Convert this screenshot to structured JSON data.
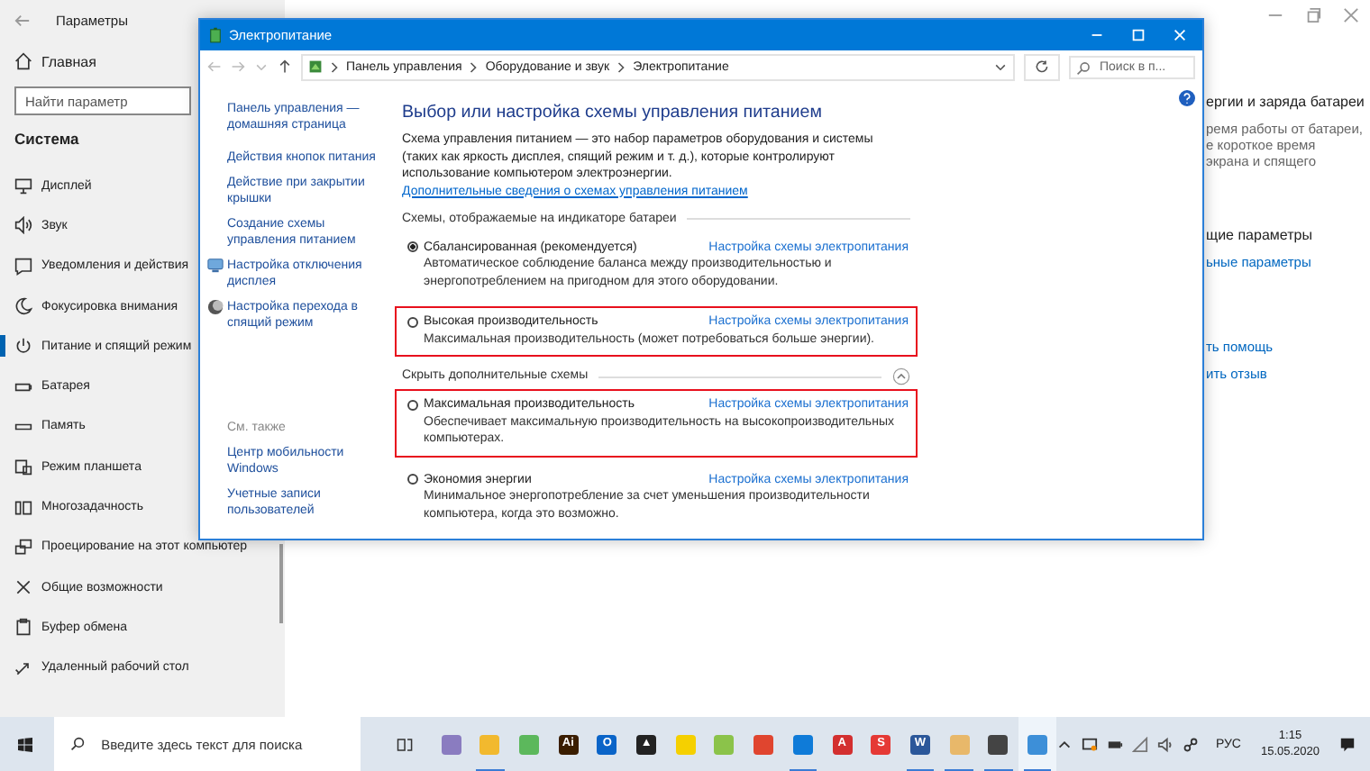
{
  "settings": {
    "title": "Параметры",
    "home": "Главная",
    "search": {
      "placeholder": "Найти параметр"
    },
    "section": "Система",
    "items": [
      {
        "label": "Дисплей",
        "selected": false
      },
      {
        "label": "Звук",
        "selected": false
      },
      {
        "label": "Уведомления и действия",
        "selected": false
      },
      {
        "label": "Фокусировка внимания",
        "selected": false
      },
      {
        "label": "Питание и спящий режим",
        "selected": true
      },
      {
        "label": "Батарея",
        "selected": false
      },
      {
        "label": "Память",
        "selected": false
      },
      {
        "label": "Режим планшета",
        "selected": false
      },
      {
        "label": "Многозадачность",
        "selected": false
      },
      {
        "label": "Проецирование на этот компьютер",
        "selected": false
      },
      {
        "label": "Общие возможности",
        "selected": false
      },
      {
        "label": "Буфер обмена",
        "selected": false
      },
      {
        "label": "Удаленный рабочий стол",
        "selected": false
      }
    ],
    "content": [
      {
        "kind": "heading",
        "text": "ергии и заряда батареи"
      },
      {
        "kind": "note",
        "text": "ремя работы от батареи,"
      },
      {
        "kind": "note",
        "text": "е короткое время"
      },
      {
        "kind": "note",
        "text": "экрана и спящего"
      },
      {
        "kind": "gap"
      },
      {
        "kind": "heading",
        "text": "щие параметры"
      },
      {
        "kind": "link",
        "text": "ьные параметры"
      },
      {
        "kind": "gap"
      },
      {
        "kind": "link",
        "text": "ть помощь"
      },
      {
        "kind": "link",
        "text": "ить отзыв"
      }
    ]
  },
  "window": {
    "title": "Электропитание",
    "breadcrumb": [
      "Панель управления",
      "Оборудование и звук",
      "Электропитание"
    ],
    "search": {
      "placeholder": "Поиск в п..."
    },
    "nav": [
      {
        "label": "Панель управления — домашняя страница",
        "kind": "plain"
      },
      {
        "label": "Действия кнопок питания",
        "kind": "plain"
      },
      {
        "label": "Действие при закрытии крышки",
        "kind": "plain"
      },
      {
        "label": "Создание схемы управления питанием",
        "kind": "plain"
      },
      {
        "label": "Настройка отключения дисплея",
        "kind": "display"
      },
      {
        "label": "Настройка перехода в спящий режим",
        "kind": "sleep"
      }
    ],
    "see_also": {
      "title": "См. также",
      "links": [
        "Центр мобильности Windows",
        "Учетные записи пользователей"
      ]
    },
    "heading": "Выбор или настройка схемы управления питанием",
    "description": "Схема управления питанием — это набор параметров оборудования и системы (таких как яркость дисплея, спящий режим и т. д.), которые контролируют использование компьютером электроэнергии.",
    "more_link": "Дополнительные сведения о схемах управления питанием",
    "sections": [
      {
        "kind": "header",
        "title": "Схемы, отображаемые на индикаторе батареи",
        "plans": [
          {
            "name": "Сбалансированная (рекомендуется)",
            "description": "Автоматическое соблюдение баланса между производительностью и энергопотреблением на пригодном для этого оборудовании.",
            "link": "Настройка схемы электропитания",
            "selected": true,
            "highlighted": false
          },
          {
            "name": "Высокая производительность",
            "description": "Максимальная производительность (может потребоваться больше энергии).",
            "link": "Настройка схемы электропитания",
            "selected": false,
            "highlighted": true
          }
        ]
      },
      {
        "kind": "toggle",
        "title": "Скрыть дополнительные схемы",
        "expanded": true,
        "plans": [
          {
            "name": "Максимальная производительность",
            "description": "Обеспечивает максимальную производительность на высокопроизводительных компьютерах.",
            "link": "Настройка схемы электропитания",
            "selected": false,
            "highlighted": true
          },
          {
            "name": "Экономия энергии",
            "description": "Минимальное энергопотребление за счет уменьшения производительности компьютера, когда это возможно.",
            "link": "Настройка схемы электропитания",
            "selected": false,
            "highlighted": false
          }
        ]
      }
    ]
  },
  "taskbar": {
    "search": {
      "placeholder": "Введите здесь текст для поиска"
    },
    "apps": [
      {
        "color": "#8a7cc0",
        "running": false,
        "selected": false
      },
      {
        "color": "#f2b92e",
        "running": true,
        "selected": false
      },
      {
        "color": "#5cb85c",
        "running": false,
        "selected": false
      },
      {
        "color": "#3a1d00",
        "glyph": "Ai",
        "running": false,
        "selected": false
      },
      {
        "color": "#0a64c8",
        "glyph": "O",
        "running": false,
        "selected": false
      },
      {
        "color": "#222222",
        "glyph": "▲",
        "running": false,
        "selected": false
      },
      {
        "color": "#f5d000",
        "running": false,
        "selected": false
      },
      {
        "color": "#8bc34a",
        "running": false,
        "selected": false
      },
      {
        "color": "#e0452f",
        "running": false,
        "selected": false
      },
      {
        "color": "#0f7bd8",
        "running": true,
        "selected": false
      },
      {
        "color": "#d32f2f",
        "glyph": "A",
        "running": false,
        "selected": false
      },
      {
        "color": "#e53935",
        "glyph": "S",
        "running": false,
        "selected": false
      },
      {
        "color": "#2b579a",
        "glyph": "W",
        "running": true,
        "selected": false
      },
      {
        "color": "#e8b86a",
        "running": true,
        "selected": false
      },
      {
        "color": "#444444",
        "running": true,
        "selected": false
      },
      {
        "color": "#3d8fd8",
        "running": true,
        "selected": true
      }
    ],
    "language": "РУС",
    "time": "1:15",
    "date": "15.05.2020"
  }
}
